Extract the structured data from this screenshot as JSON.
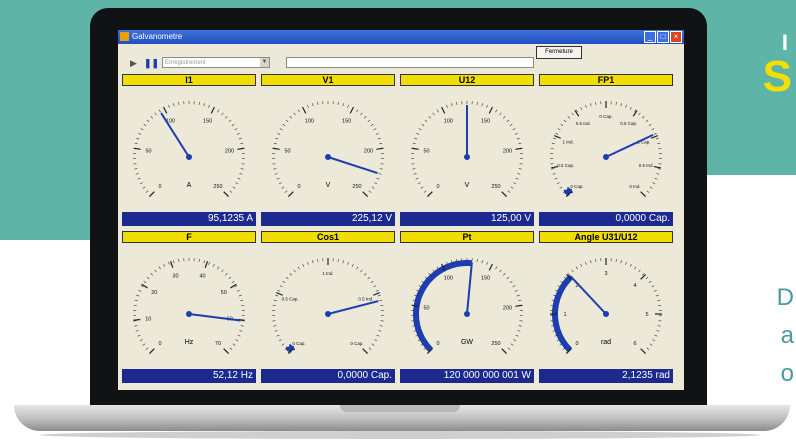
{
  "window": {
    "title": "Galvanometre"
  },
  "toolbar": {
    "recording_combo_placeholder": "Enregistrement",
    "close_label": "Fermeture"
  },
  "gauges": [
    {
      "title": "I1",
      "unit": "A",
      "value": "95,1235 A",
      "needle_fraction": 0.38,
      "bar_fraction": 0,
      "ticks": [
        "0",
        "50",
        "100",
        "150",
        "200",
        "250"
      ]
    },
    {
      "title": "V1",
      "unit": "V",
      "value": "225,12 V",
      "needle_fraction": 0.9,
      "bar_fraction": 0,
      "ticks": [
        "0",
        "50",
        "100",
        "150",
        "200",
        "250"
      ]
    },
    {
      "title": "U12",
      "unit": "V",
      "value": "125,00 V",
      "needle_fraction": 0.5,
      "bar_fraction": 0,
      "ticks": [
        "0",
        "50",
        "100",
        "150",
        "200",
        "250"
      ]
    },
    {
      "title": "FP1",
      "unit": "",
      "value": "0,0000 Cap.",
      "needle_fraction": 0.74,
      "bar_fraction": 0.02,
      "ticks": [
        "0 Cap.",
        "0.5 Cap.",
        "1 Ind.",
        "0.5 Ind.",
        "0 Cap.",
        "0.5 Cap.",
        "1 Cap.",
        "0.5 Ind.",
        "0 Ind."
      ]
    },
    {
      "title": "F",
      "unit": "Hz",
      "value": "52,12 Hz",
      "needle_fraction": 0.86,
      "bar_fraction": 0,
      "ticks": [
        "0",
        "10",
        "20",
        "30",
        "40",
        "50",
        "60",
        "70"
      ]
    },
    {
      "title": "Cos1",
      "unit": "",
      "value": "0,0000 Cap.",
      "needle_fraction": 0.78,
      "bar_fraction": 0.02,
      "ticks": [
        "0 Cap.",
        "0.5 Cap.",
        "1 Ind.",
        "0.5 Ind.",
        "0 Cap."
      ]
    },
    {
      "title": "Pt",
      "unit": "GW",
      "value": "120 000 000 001 W",
      "needle_fraction": 0.52,
      "bar_fraction": 0.52,
      "ticks": [
        "0",
        "50",
        "100",
        "150",
        "200",
        "250"
      ]
    },
    {
      "title": "Angle U31/U12",
      "unit": "rad",
      "value": "2,1235 rad",
      "needle_fraction": 0.34,
      "bar_fraction": 0.34,
      "ticks": [
        "0",
        "1",
        "2",
        "3",
        "4",
        "5",
        "6"
      ]
    }
  ],
  "colors": {
    "needle": "#1c3eb0",
    "bar": "#1c3eb0",
    "header": "#f1de00",
    "value_bg": "#1c2a8f"
  }
}
